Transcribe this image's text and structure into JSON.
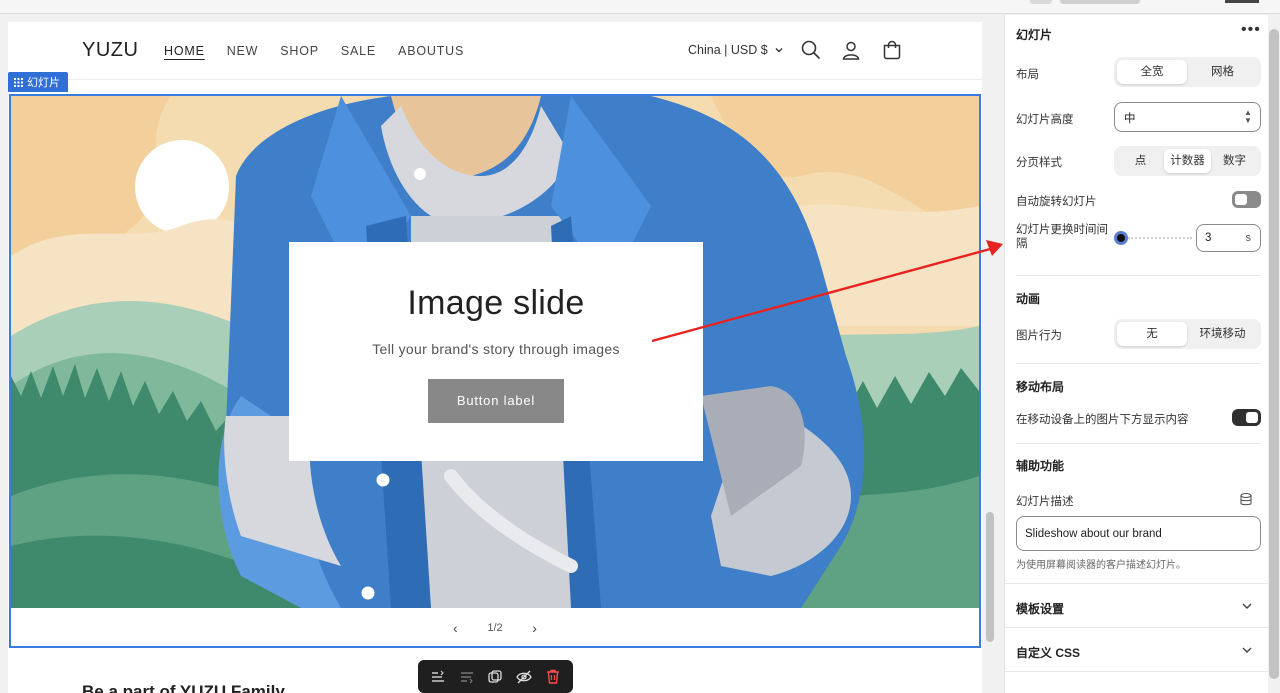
{
  "store": {
    "logo": "YUZU",
    "nav": [
      "HOME",
      "NEW",
      "SHOP",
      "SALE",
      "ABOUTUS"
    ],
    "currency": "China | USD $",
    "icons": [
      "search-icon",
      "account-icon",
      "cart-icon"
    ]
  },
  "slideshow": {
    "tag": "幻灯片",
    "heading": "Image slide",
    "subheading": "Tell your brand's story through images",
    "button_label": "Button label",
    "pager": "1/2"
  },
  "footer_heading": "Be a part of YUZU Family",
  "panel": {
    "title": "幻灯片",
    "layout_label": "布局",
    "layout_options": [
      "全宽",
      "网格"
    ],
    "layout_selected": "全宽",
    "height_label": "幻灯片高度",
    "height_value": "中",
    "pagination_label": "分页样式",
    "pagination_options": [
      "点",
      "计数器",
      "数字"
    ],
    "pagination_selected": "计数器",
    "autorotate_label": "自动旋转幻灯片",
    "autorotate_on": false,
    "interval_label": "幻灯片更换时间间隔",
    "interval_value": "3",
    "interval_unit": "s",
    "animation_section": "动画",
    "image_behavior_label": "图片行为",
    "image_behavior_options": [
      "无",
      "环境移动"
    ],
    "image_behavior_selected": "无",
    "mobile_section": "移动布局",
    "mobile_label": "在移动设备上的图片下方显示内容",
    "mobile_on": true,
    "accessibility_section": "辅助功能",
    "desc_label": "幻灯片描述",
    "desc_value": "Slideshow about our brand",
    "desc_hint": "为使用屏幕阅读器的客户描述幻灯片。",
    "theme_settings": "模板设置",
    "custom_css": "自定义 CSS"
  },
  "colors": {
    "accent": "#2f6fd6",
    "arrow": "#e8231f"
  }
}
